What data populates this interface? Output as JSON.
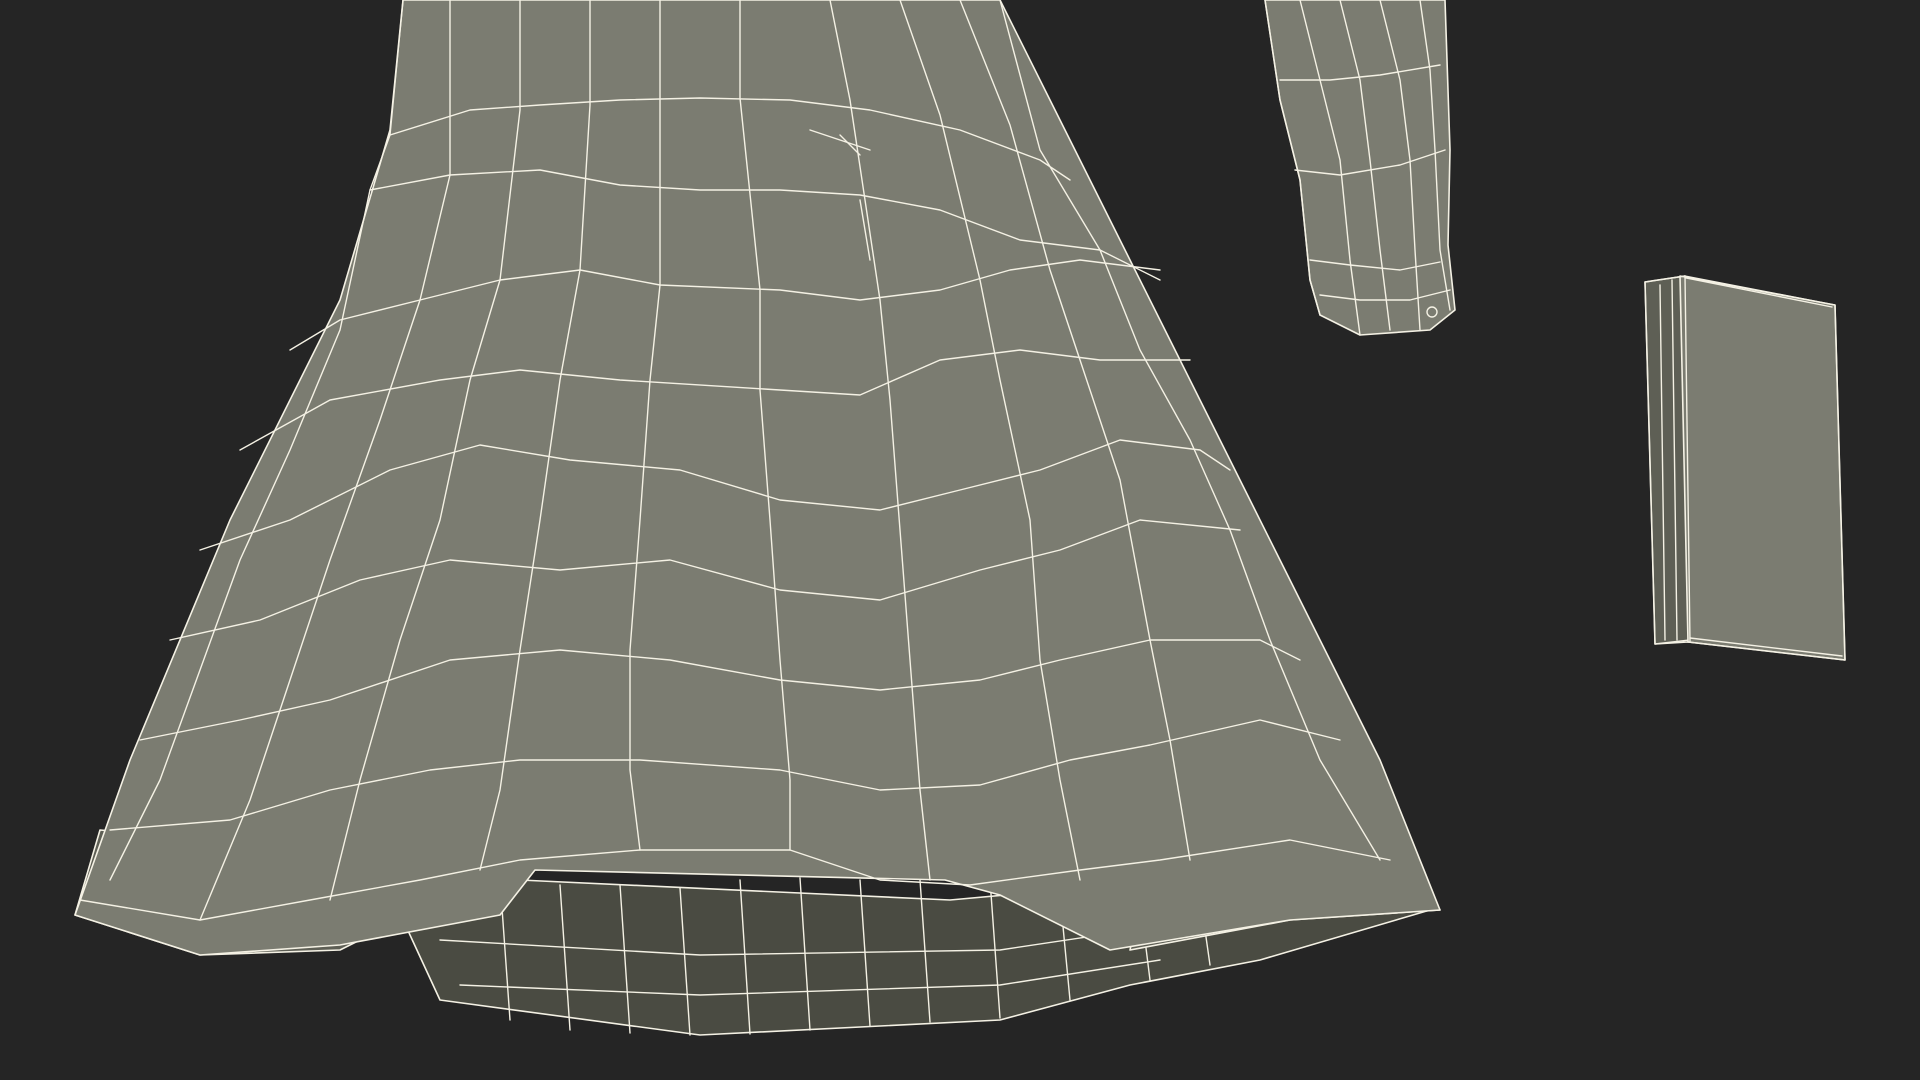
{
  "scene": {
    "background_color": "#252525",
    "mesh_surface_color": "#7b7c71",
    "mesh_inner_color": "#4a4b42",
    "mesh_shadow_color": "#5e5f55",
    "wireframe_color": "#f4f1e4",
    "objects": [
      "skirt",
      "sleeve-cuff",
      "book"
    ]
  }
}
